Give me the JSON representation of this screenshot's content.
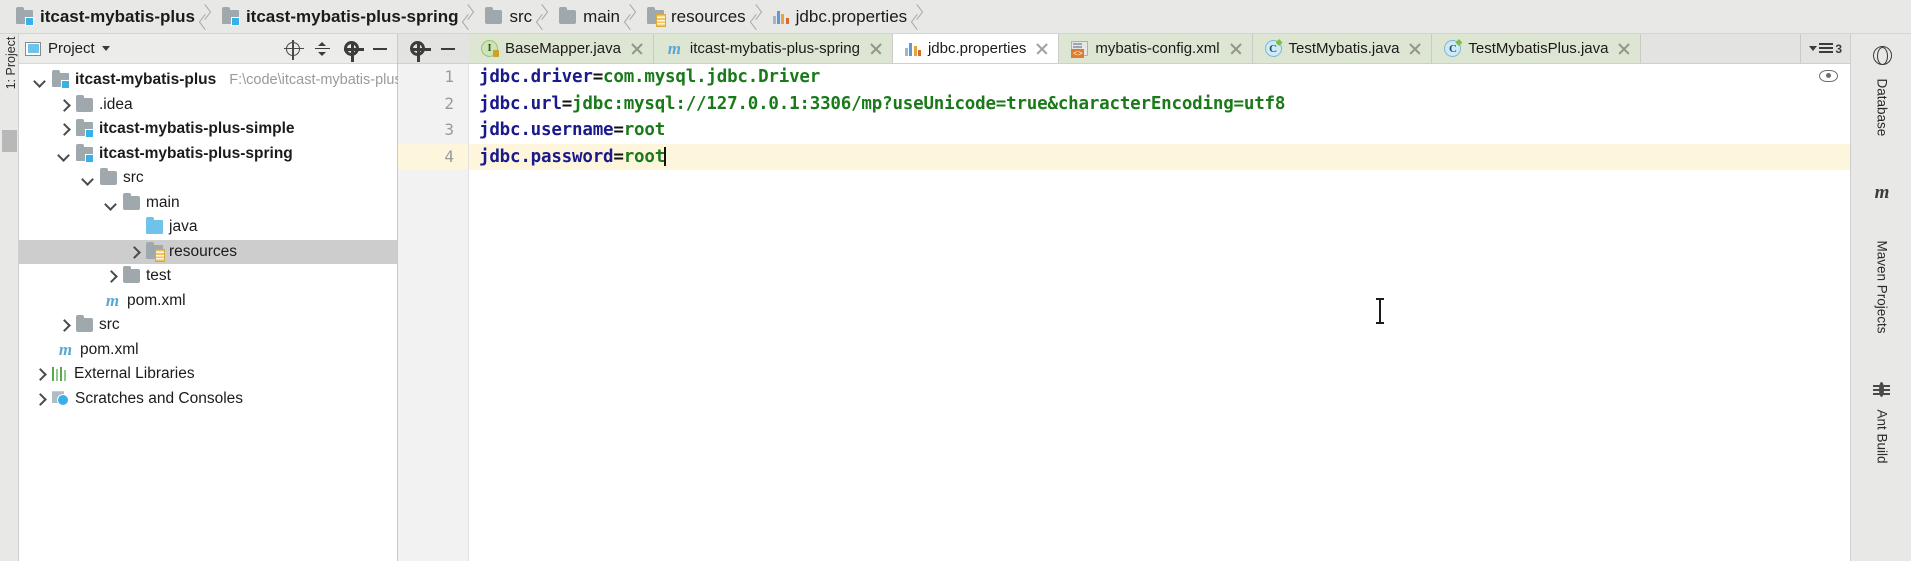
{
  "breadcrumb": {
    "items": [
      {
        "label": "itcast-mybatis-plus",
        "icon": "module-icon",
        "bold": true
      },
      {
        "label": "itcast-mybatis-plus-spring",
        "icon": "module-icon",
        "bold": true
      },
      {
        "label": "src",
        "icon": "folder-icon",
        "bold": false
      },
      {
        "label": "main",
        "icon": "folder-icon",
        "bold": false
      },
      {
        "label": "resources",
        "icon": "resources-folder-icon",
        "bold": false
      },
      {
        "label": "jdbc.properties",
        "icon": "properties-file-icon",
        "bold": false
      }
    ]
  },
  "left_strip": {
    "tool_window_label": "1: Project"
  },
  "project_panel": {
    "title": "Project",
    "toolbar": {
      "locate_icon": "target-icon",
      "collapse_icon": "collapse-all-icon",
      "settings_icon": "gear-icon",
      "hide_icon": "minimize-icon",
      "dropdown_icon": "chevron-down-icon"
    },
    "tree": [
      {
        "label": "itcast-mybatis-plus",
        "path": "F:\\code\\itcast-mybatis-plus",
        "indent": 0,
        "arrow": "down",
        "icon": "module-icon",
        "bold": true,
        "selected": false
      },
      {
        "label": ".idea",
        "path": "",
        "indent": 1,
        "arrow": "right",
        "icon": "folder-icon",
        "bold": false,
        "selected": false
      },
      {
        "label": "itcast-mybatis-plus-simple",
        "path": "",
        "indent": 1,
        "arrow": "right",
        "icon": "module-icon",
        "bold": true,
        "selected": false
      },
      {
        "label": "itcast-mybatis-plus-spring",
        "path": "",
        "indent": 1,
        "arrow": "down",
        "icon": "module-icon",
        "bold": true,
        "selected": false
      },
      {
        "label": "src",
        "path": "",
        "indent": 2,
        "arrow": "down",
        "icon": "folder-icon",
        "bold": false,
        "selected": false
      },
      {
        "label": "main",
        "path": "",
        "indent": 3,
        "arrow": "down",
        "icon": "folder-icon",
        "bold": false,
        "selected": false
      },
      {
        "label": "java",
        "path": "",
        "indent": 4,
        "arrow": "none",
        "icon": "java-source-folder-icon",
        "bold": false,
        "selected": false
      },
      {
        "label": "resources",
        "path": "",
        "indent": 4,
        "arrow": "right",
        "icon": "resources-folder-icon",
        "bold": false,
        "selected": true
      },
      {
        "label": "test",
        "path": "",
        "indent": 3,
        "arrow": "right",
        "icon": "folder-icon",
        "bold": false,
        "selected": false
      },
      {
        "label": "pom.xml",
        "path": "",
        "indent": 3,
        "arrow": "none",
        "icon": "maven-file-icon",
        "bold": false,
        "selected": false
      },
      {
        "label": "src",
        "path": "",
        "indent": 1,
        "arrow": "right",
        "icon": "folder-icon",
        "bold": false,
        "selected": false
      },
      {
        "label": "pom.xml",
        "path": "",
        "indent": 1,
        "arrow": "none",
        "icon": "maven-file-icon",
        "bold": false,
        "selected": false
      },
      {
        "label": "External Libraries",
        "path": "",
        "indent": 0,
        "arrow": "right",
        "icon": "external-libraries-icon",
        "bold": false,
        "selected": false
      },
      {
        "label": "Scratches and Consoles",
        "path": "",
        "indent": 0,
        "arrow": "right",
        "icon": "scratches-icon",
        "bold": false,
        "selected": false
      }
    ]
  },
  "editor": {
    "tabs": [
      {
        "label": "BaseMapper.java",
        "icon": "interface-icon",
        "style": "green",
        "active": false,
        "close": "close-icon"
      },
      {
        "label": "itcast-mybatis-plus-spring",
        "icon": "maven-file-icon",
        "style": "green",
        "active": false,
        "close": "close-icon"
      },
      {
        "label": "jdbc.properties",
        "icon": "properties-file-icon",
        "style": "active",
        "active": true,
        "close": "close-icon"
      },
      {
        "label": "mybatis-config.xml",
        "icon": "xml-file-icon",
        "style": "green",
        "active": false,
        "close": "close-icon"
      },
      {
        "label": "TestMybatis.java",
        "icon": "class-icon",
        "style": "green",
        "active": false,
        "close": "close-icon"
      },
      {
        "label": "TestMybatisPlus.java",
        "icon": "class-icon",
        "style": "green",
        "active": false,
        "close": "close-icon"
      }
    ],
    "tab_overflow_count": "3",
    "inspection_icon": "eye-icon",
    "gutter_lines": [
      "1",
      "2",
      "3",
      "4"
    ],
    "current_line": 4,
    "lines": [
      {
        "n": "1",
        "key": "jdbc.driver",
        "eq": "=",
        "value": "com.mysql.jdbc.Driver"
      },
      {
        "n": "2",
        "key": "jdbc.url",
        "eq": "=",
        "value": "jdbc:mysql://127.0.0.1:3306/mp?useUnicode=true&characterEncoding=utf8"
      },
      {
        "n": "3",
        "key": "jdbc.username",
        "eq": "=",
        "value": "root"
      },
      {
        "n": "4",
        "key": "jdbc.password",
        "eq": "=",
        "value": "root"
      }
    ]
  },
  "right_strip": {
    "items": [
      {
        "label": "Database",
        "icon": "database-icon"
      },
      {
        "label": "Maven Projects",
        "icon": "maven-icon"
      },
      {
        "label": "Ant Build",
        "icon": "ant-icon"
      }
    ]
  },
  "colors": {
    "key": "#1a1a8c",
    "value": "#1a7a1a",
    "current_line_bg": "#fdf6dd",
    "selection_bg": "#cdcdcd",
    "tab_active_bg": "#ffffff",
    "tab_inactive_bg": "#dde6d2",
    "chrome_bg": "#e8e8e7"
  }
}
